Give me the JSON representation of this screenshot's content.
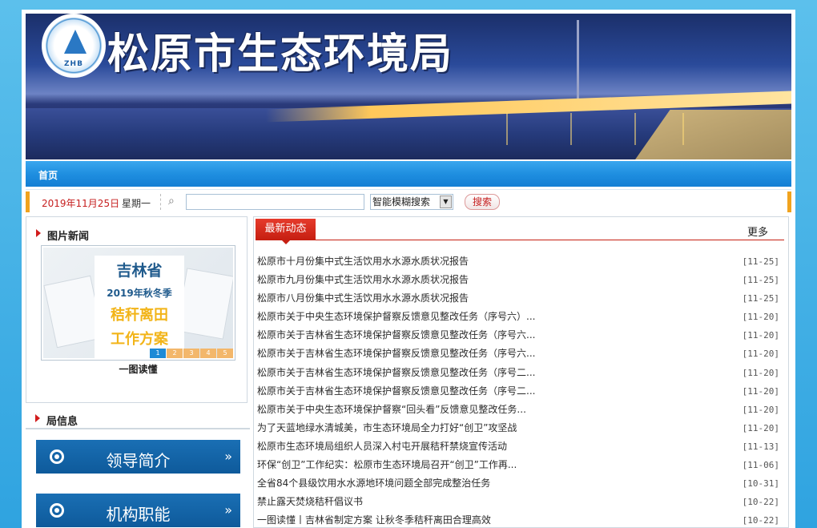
{
  "header": {
    "site_title": "松原市生态环境局",
    "logo_text": "ZHB"
  },
  "nav": {
    "items": [
      "首页"
    ]
  },
  "toolbar": {
    "date": "2019年11月25日",
    "weekday": "星期一",
    "search_placeholder": "",
    "search_mode": "智能模糊搜索",
    "search_button": "搜索"
  },
  "photo_news": {
    "title": "图片新闻",
    "image_lines": [
      "吉林省",
      "2019年秋冬季",
      "秸秆离田",
      "工作方案"
    ],
    "pager": [
      "1",
      "2",
      "3",
      "4",
      "5"
    ],
    "caption": "一图读懂"
  },
  "bureau_info": {
    "title": "局信息",
    "buttons": [
      "领导简介",
      "机构职能"
    ],
    "chevron": "»"
  },
  "news": {
    "tab_label": "最新动态",
    "more_label": "更多",
    "items": [
      {
        "title": "松原市十月份集中式生活饮用水水源水质状况报告",
        "date": "[11-25]"
      },
      {
        "title": "松原市九月份集中式生活饮用水水源水质状况报告",
        "date": "[11-25]"
      },
      {
        "title": "松原市八月份集中式生活饮用水水源水质状况报告",
        "date": "[11-25]"
      },
      {
        "title": "松原市关于中央生态环境保护督察反馈意见整改任务（序号六）...",
        "date": "[11-20]"
      },
      {
        "title": "松原市关于吉林省生态环境保护督察反馈意见整改任务（序号六...",
        "date": "[11-20]"
      },
      {
        "title": "松原市关于吉林省生态环境保护督察反馈意见整改任务（序号六...",
        "date": "[11-20]"
      },
      {
        "title": "松原市关于吉林省生态环境保护督察反馈意见整改任务（序号二...",
        "date": "[11-20]"
      },
      {
        "title": "松原市关于吉林省生态环境保护督察反馈意见整改任务（序号二...",
        "date": "[11-20]"
      },
      {
        "title": "松原市关于中央生态环境保护督察“回头看”反馈意见整改任务...",
        "date": "[11-20]"
      },
      {
        "title": "为了天蓝地绿水清城美，市生态环境局全力打好“创卫”攻坚战",
        "date": "[11-20]"
      },
      {
        "title": "松原市生态环境局组织人员深入村屯开展秸秆禁烧宣传活动",
        "date": "[11-13]"
      },
      {
        "title": "环保“创卫”工作纪实：松原市生态环境局召开“创卫”工作再...",
        "date": "[11-06]"
      },
      {
        "title": "全省84个县级饮用水水源地环境问题全部完成整治任务",
        "date": "[10-31]"
      },
      {
        "title": "禁止露天焚烧秸秆倡议书",
        "date": "[10-22]"
      },
      {
        "title": "一图读懂丨吉林省制定方案 让秋冬季秸秆离田合理高效",
        "date": "[10-22]"
      }
    ]
  },
  "colors": {
    "accent_red": "#c61f1f",
    "nav_blue": "#1f8fe0",
    "button_blue": "#0e5a9b",
    "toolbar_edge": "#f1a31e"
  }
}
